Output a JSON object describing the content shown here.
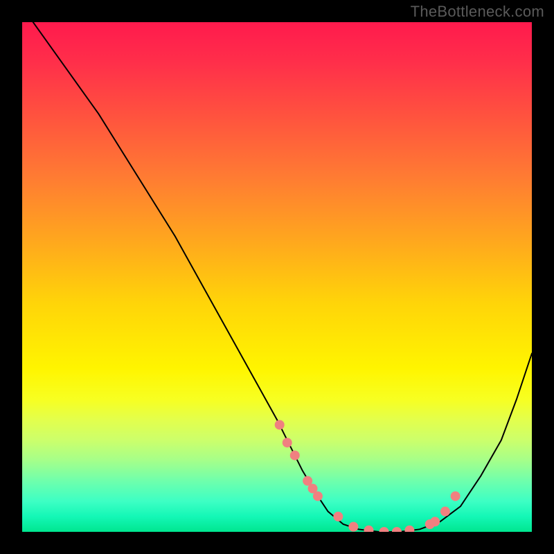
{
  "watermark": "TheBottleneck.com",
  "chart_data": {
    "type": "line",
    "title": "",
    "xlabel": "",
    "ylabel": "",
    "xlim": [
      0,
      100
    ],
    "ylim": [
      0,
      100
    ],
    "series": [
      {
        "name": "bottleneck-curve",
        "x": [
          0,
          5,
          10,
          15,
          20,
          25,
          30,
          35,
          40,
          45,
          50,
          52,
          55,
          58,
          60,
          63,
          66,
          70,
          74,
          78,
          82,
          86,
          90,
          94,
          97,
          100
        ],
        "y": [
          103,
          96,
          89,
          82,
          74,
          66,
          58,
          49,
          40,
          31,
          22,
          18,
          12,
          7,
          4,
          1.5,
          0.5,
          0,
          0,
          0.5,
          2,
          5,
          11,
          18,
          26,
          35
        ]
      }
    ],
    "scatter_points": {
      "name": "highlighted-points",
      "color": "#f08080",
      "x": [
        50.5,
        52,
        53.5,
        56,
        57,
        58,
        62,
        65,
        68,
        71,
        73.5,
        76,
        80,
        81,
        83,
        85
      ],
      "y": [
        21,
        17.5,
        15,
        10,
        8.5,
        7,
        3,
        1,
        0.3,
        0,
        0,
        0.3,
        1.5,
        2,
        4,
        7
      ]
    },
    "gradient": {
      "top": "#ff1a4d",
      "middle": "#fff500",
      "bottom": "#00e68f"
    }
  }
}
